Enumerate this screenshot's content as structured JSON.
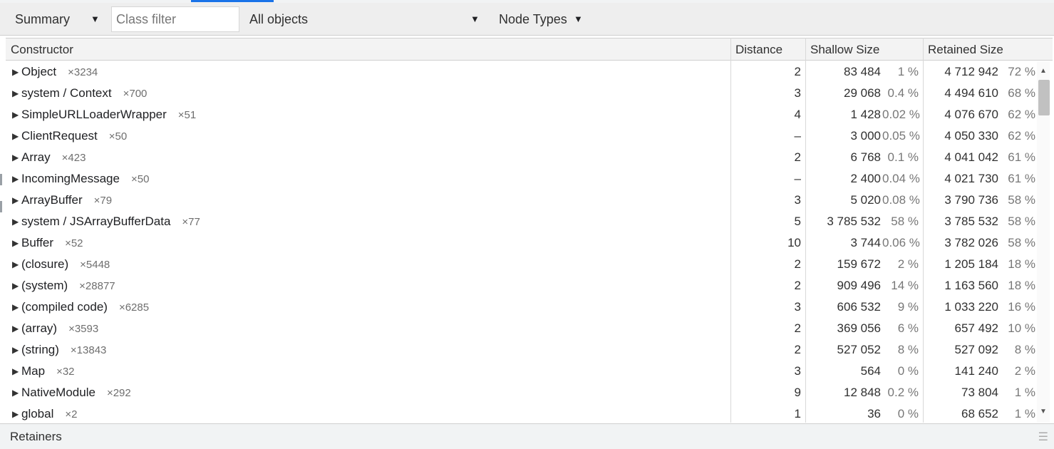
{
  "toolbar": {
    "view_label": "Summary",
    "filter_placeholder": "Class filter",
    "objects_label": "All objects",
    "node_types_label": "Node Types"
  },
  "columns": {
    "constructor": "Constructor",
    "distance": "Distance",
    "shallow": "Shallow Size",
    "retained": "Retained Size"
  },
  "rows": [
    {
      "name": "Object",
      "count": "×3234",
      "distance": "2",
      "shallow": "83 484",
      "shallow_pct": "1 %",
      "retained": "4 712 942",
      "retained_pct": "72 %"
    },
    {
      "name": "system / Context",
      "count": "×700",
      "distance": "3",
      "shallow": "29 068",
      "shallow_pct": "0.4 %",
      "retained": "4 494 610",
      "retained_pct": "68 %"
    },
    {
      "name": "SimpleURLLoaderWrapper",
      "count": "×51",
      "distance": "4",
      "shallow": "1 428",
      "shallow_pct": "0.02 %",
      "retained": "4 076 670",
      "retained_pct": "62 %"
    },
    {
      "name": "ClientRequest",
      "count": "×50",
      "distance": "–",
      "shallow": "3 000",
      "shallow_pct": "0.05 %",
      "retained": "4 050 330",
      "retained_pct": "62 %"
    },
    {
      "name": "Array",
      "count": "×423",
      "distance": "2",
      "shallow": "6 768",
      "shallow_pct": "0.1 %",
      "retained": "4 041 042",
      "retained_pct": "61 %"
    },
    {
      "name": "IncomingMessage",
      "count": "×50",
      "distance": "–",
      "shallow": "2 400",
      "shallow_pct": "0.04 %",
      "retained": "4 021 730",
      "retained_pct": "61 %"
    },
    {
      "name": "ArrayBuffer",
      "count": "×79",
      "distance": "3",
      "shallow": "5 020",
      "shallow_pct": "0.08 %",
      "retained": "3 790 736",
      "retained_pct": "58 %"
    },
    {
      "name": "system / JSArrayBufferData",
      "count": "×77",
      "distance": "5",
      "shallow": "3 785 532",
      "shallow_pct": "58 %",
      "retained": "3 785 532",
      "retained_pct": "58 %"
    },
    {
      "name": "Buffer",
      "count": "×52",
      "distance": "10",
      "shallow": "3 744",
      "shallow_pct": "0.06 %",
      "retained": "3 782 026",
      "retained_pct": "58 %"
    },
    {
      "name": "(closure)",
      "count": "×5448",
      "distance": "2",
      "shallow": "159 672",
      "shallow_pct": "2 %",
      "retained": "1 205 184",
      "retained_pct": "18 %"
    },
    {
      "name": "(system)",
      "count": "×28877",
      "distance": "2",
      "shallow": "909 496",
      "shallow_pct": "14 %",
      "retained": "1 163 560",
      "retained_pct": "18 %"
    },
    {
      "name": "(compiled code)",
      "count": "×6285",
      "distance": "3",
      "shallow": "606 532",
      "shallow_pct": "9 %",
      "retained": "1 033 220",
      "retained_pct": "16 %"
    },
    {
      "name": "(array)",
      "count": "×3593",
      "distance": "2",
      "shallow": "369 056",
      "shallow_pct": "6 %",
      "retained": "657 492",
      "retained_pct": "10 %"
    },
    {
      "name": "(string)",
      "count": "×13843",
      "distance": "2",
      "shallow": "527 052",
      "shallow_pct": "8 %",
      "retained": "527 092",
      "retained_pct": "8 %"
    },
    {
      "name": "Map",
      "count": "×32",
      "distance": "3",
      "shallow": "564",
      "shallow_pct": "0 %",
      "retained": "141 240",
      "retained_pct": "2 %"
    },
    {
      "name": "NativeModule",
      "count": "×292",
      "distance": "9",
      "shallow": "12 848",
      "shallow_pct": "0.2 %",
      "retained": "73 804",
      "retained_pct": "1 %"
    },
    {
      "name": "global",
      "count": "×2",
      "distance": "1",
      "shallow": "36",
      "shallow_pct": "0 %",
      "retained": "68 652",
      "retained_pct": "1 %"
    }
  ],
  "retainers": {
    "title": "Retainers"
  }
}
